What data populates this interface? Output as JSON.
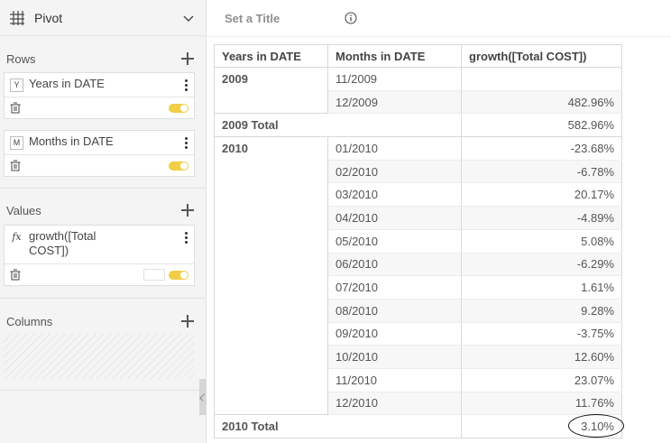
{
  "panel": {
    "title": "Pivot",
    "rows_label": "Rows",
    "values_label": "Values",
    "columns_label": "Columns",
    "row_fields": [
      {
        "badge": "Y",
        "label": "Years in DATE"
      },
      {
        "badge": "M",
        "label": "Months in DATE"
      }
    ],
    "value_fields": [
      {
        "badge": "fx",
        "label_line1": "growth([Total",
        "label_line2": "COST])"
      }
    ]
  },
  "chart": {
    "title_placeholder": "Set a Title"
  },
  "table": {
    "headers": [
      "Years in DATE",
      "Months in DATE",
      "growth([Total COST])"
    ],
    "groups": [
      {
        "year": "2009",
        "rows": [
          {
            "month": "11/2009",
            "value": ""
          },
          {
            "month": "12/2009",
            "value": "482.96%"
          }
        ],
        "total_label": "2009 Total",
        "total_value": "582.96%"
      },
      {
        "year": "2010",
        "rows": [
          {
            "month": "01/2010",
            "value": "-23.68%"
          },
          {
            "month": "02/2010",
            "value": "-6.78%"
          },
          {
            "month": "03/2010",
            "value": "20.17%"
          },
          {
            "month": "04/2010",
            "value": "-4.89%"
          },
          {
            "month": "05/2010",
            "value": "5.08%"
          },
          {
            "month": "06/2010",
            "value": "-6.29%"
          },
          {
            "month": "07/2010",
            "value": "1.61%"
          },
          {
            "month": "08/2010",
            "value": "9.28%"
          },
          {
            "month": "09/2010",
            "value": "-3.75%"
          },
          {
            "month": "10/2010",
            "value": "12.60%"
          },
          {
            "month": "11/2010",
            "value": "23.07%"
          },
          {
            "month": "12/2010",
            "value": "11.76%"
          }
        ],
        "total_label": "2010 Total",
        "total_value": "3.10%"
      }
    ]
  },
  "colors": {
    "toggle_on": "#f2cd46",
    "panel_bg": "#f4f4f4",
    "row_stripe": "#f7f7f7"
  }
}
